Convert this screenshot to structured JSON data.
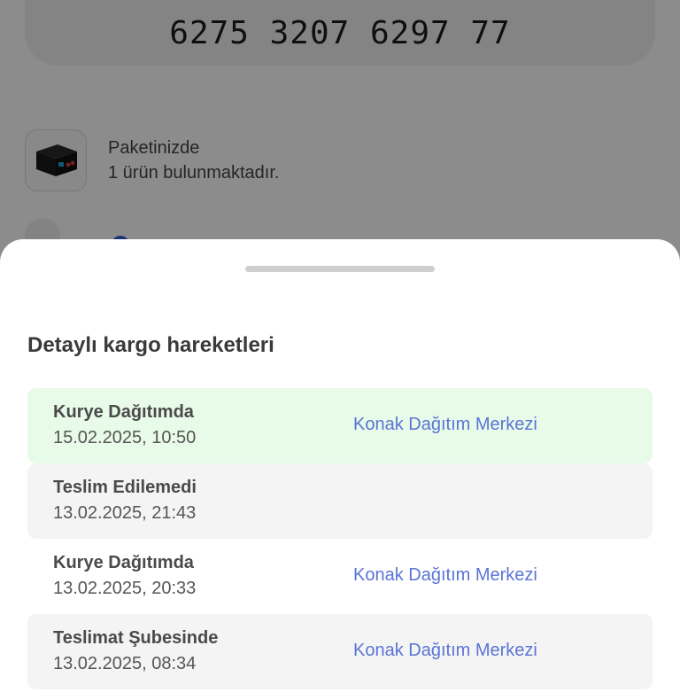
{
  "background": {
    "tracking_number": "6275 3207 6297 77",
    "package": {
      "line1": "Paketinizde",
      "line2": "1 ürün bulunmaktadır."
    }
  },
  "sheet": {
    "title": "Detaylı kargo hareketleri",
    "events": [
      {
        "status": "Kurye Dağıtımda",
        "date": "15.02.2025, 10:50",
        "location": "Konak Dağıtım Merkezi"
      },
      {
        "status": "Teslim Edilemedi",
        "date": "13.02.2025, 21:43",
        "location": ""
      },
      {
        "status": "Kurye Dağıtımda",
        "date": "13.02.2025, 20:33",
        "location": "Konak Dağıtım Merkezi"
      },
      {
        "status": "Teslimat Şubesinde",
        "date": "13.02.2025, 08:34",
        "location": "Konak Dağıtım Merkezi"
      }
    ]
  },
  "colors": {
    "active_row": "#e7fbe8",
    "row": "#f4f4f4",
    "location_link": "#5b74d6",
    "overlay": "rgba(0,0,0,0.45)"
  }
}
